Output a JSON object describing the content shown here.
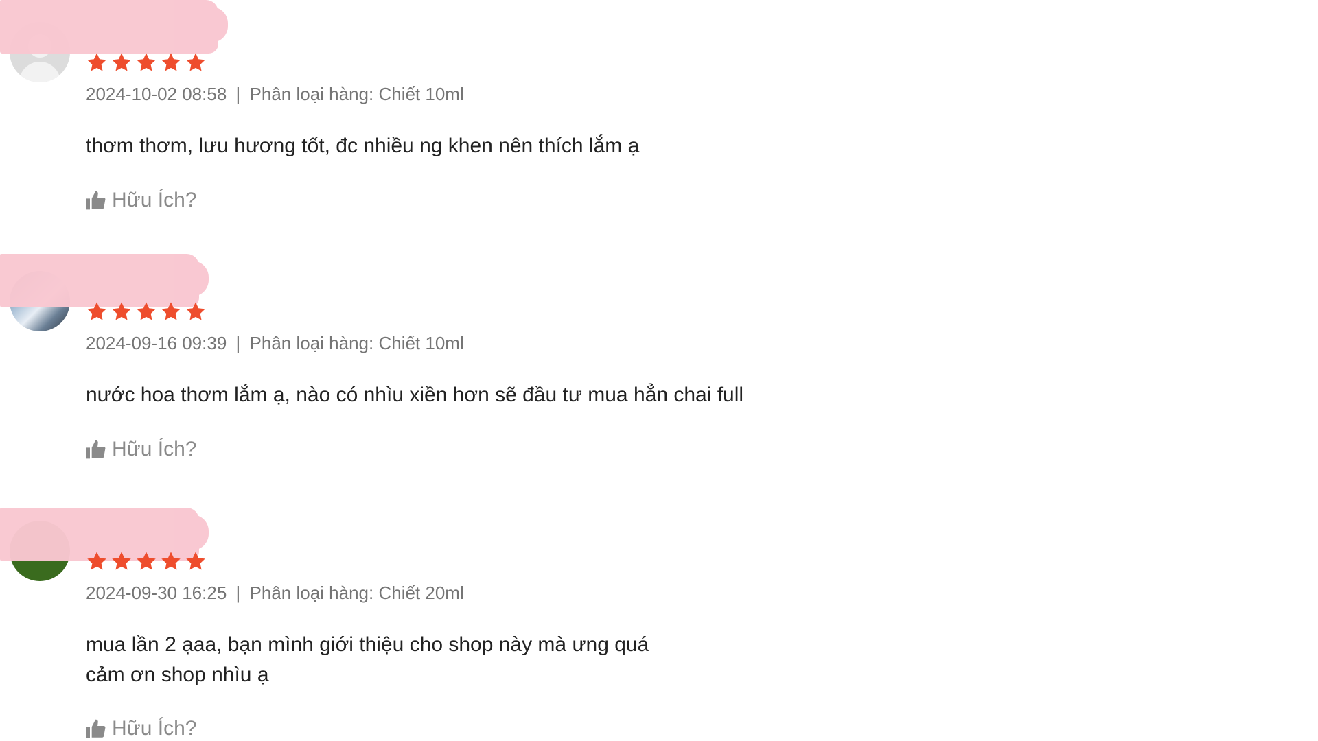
{
  "colors": {
    "star": "#ee4d2d",
    "meta_text": "#757575",
    "content_text": "#222222",
    "helpful_text": "#8a8a8a",
    "redaction": "#f9c7d1"
  },
  "icons": {
    "star": "star-icon",
    "helpful": "thumbs-up-icon"
  },
  "reviews": [
    {
      "rating": 5,
      "date": "2024-10-02 08:58",
      "separator": "|",
      "variation": "Phân loại hàng: Chiết 10ml",
      "content_lines": [
        "thơm thơm, lưu hương tốt, đc nhiều ng khen nên thích lắm ạ"
      ],
      "helpful_label": "Hữu Ích?"
    },
    {
      "rating": 5,
      "date": "2024-09-16 09:39",
      "separator": "|",
      "variation": "Phân loại hàng: Chiết 10ml",
      "content_lines": [
        "nước hoa thơm lắm ạ, nào có nhìu xiền hơn sẽ đầu tư mua hẳn chai full"
      ],
      "helpful_label": "Hữu Ích?"
    },
    {
      "rating": 5,
      "date": "2024-09-30 16:25",
      "separator": "|",
      "variation": "Phân loại hàng: Chiết 20ml",
      "content_lines": [
        "mua lần 2 ạaa, bạn mình giới thiệu cho shop này mà ưng quá",
        "cảm ơn shop nhìu ạ"
      ],
      "helpful_label": "Hữu Ích?"
    }
  ]
}
